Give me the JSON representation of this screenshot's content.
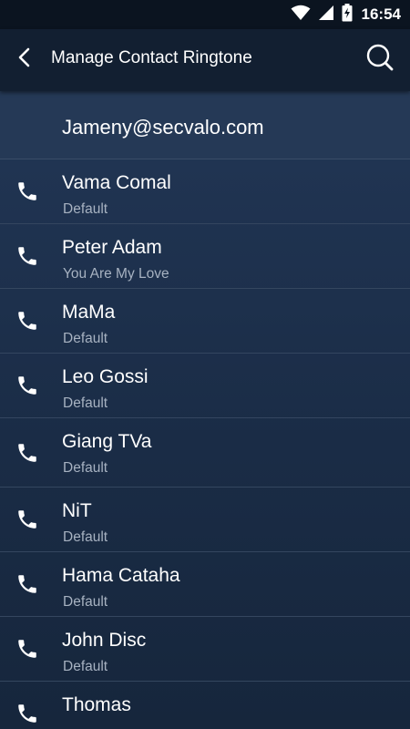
{
  "status_bar": {
    "time": "16:54",
    "icons": [
      "wifi-icon",
      "cell-signal-icon",
      "battery-charging-icon"
    ]
  },
  "app_bar": {
    "title": "Manage Contact Ringtone",
    "back_icon": "back-arrow-icon",
    "search_icon": "search-icon"
  },
  "account": {
    "email": "Jameny@secvalo.com"
  },
  "contacts": [
    {
      "name": "Vama Comal",
      "ringtone": "Default"
    },
    {
      "name": "Peter Adam",
      "ringtone": "You Are My Love"
    },
    {
      "name": "MaMa",
      "ringtone": "Default"
    },
    {
      "name": "Leo Gossi",
      "ringtone": "Default"
    },
    {
      "name": "Giang TVa",
      "ringtone": "Default"
    },
    {
      "name": "NiT",
      "ringtone": "Default"
    },
    {
      "name": "Hama Cataha",
      "ringtone": "Default"
    },
    {
      "name": "John Disc",
      "ringtone": "Default"
    },
    {
      "name": "Thomas",
      "ringtone": ""
    }
  ],
  "colors": {
    "status_bar_bg": "#0b1420",
    "app_bar_bg": "#121f31",
    "account_bg": "#253956",
    "list_bg": "#1d3049",
    "secondary_text": "#a7b2c1"
  }
}
